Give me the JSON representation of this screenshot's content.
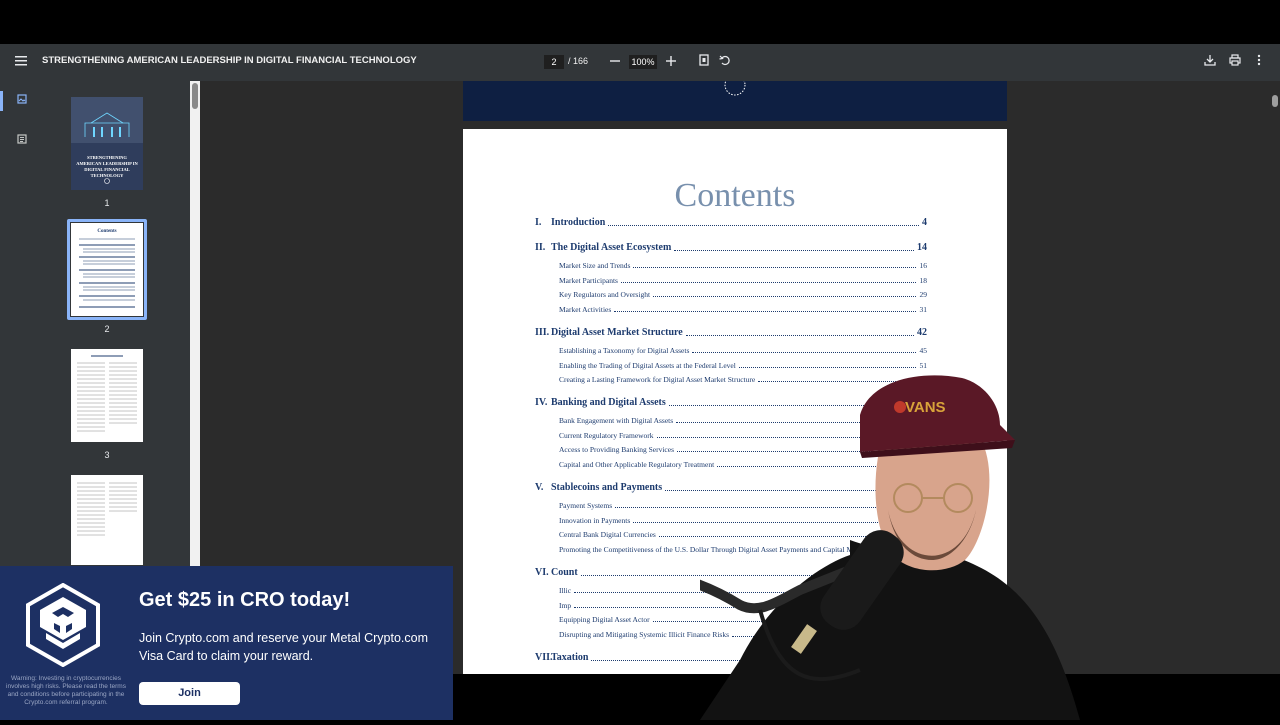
{
  "toolbar": {
    "title": "STRENGTHENING AMERICAN LEADERSHIP IN DIGITAL FINANCIAL TECHNOLOGY",
    "page_current": "2",
    "page_total": "/ 166",
    "zoom": "100%",
    "icons": [
      "menu-icon",
      "zoom-out-icon",
      "zoom-in-icon",
      "fit-page-icon",
      "rotate-icon",
      "download-icon",
      "print-icon",
      "more-icon"
    ]
  },
  "sidebar": {
    "thumbnails": [
      {
        "number": "1",
        "cover_title": "STRENGTHENING AMERICAN LEADERSHIP IN DIGITAL FINANCIAL TECHNOLOGY"
      },
      {
        "number": "2",
        "heading": "Contents"
      },
      {
        "number": "3"
      },
      {
        "number": ""
      }
    ]
  },
  "page": {
    "heading": "Contents",
    "sections": [
      {
        "numeral": "I.",
        "title": "Introduction",
        "page": "4",
        "subs": []
      },
      {
        "numeral": "II.",
        "title": "The Digital Asset Ecosystem",
        "page": "14",
        "subs": [
          {
            "title": "Market Size and Trends",
            "page": "16"
          },
          {
            "title": "Market Participants",
            "page": "18"
          },
          {
            "title": "Key Regulators and Oversight",
            "page": "29"
          },
          {
            "title": "Market Activities",
            "page": "31"
          }
        ]
      },
      {
        "numeral": "III.",
        "title": "Digital Asset Market Structure",
        "page": "42",
        "subs": [
          {
            "title": "Establishing a Taxonomy for Digital Assets",
            "page": "45"
          },
          {
            "title": "Enabling the Trading of Digital Assets at the Federal Level",
            "page": "51"
          },
          {
            "title": "Creating a Lasting Framework for Digital Asset Market Structure",
            "page": ""
          }
        ]
      },
      {
        "numeral": "IV.",
        "title": "Banking and Digital Assets",
        "page": "",
        "subs": [
          {
            "title": "Bank Engagement with Digital Assets",
            "page": ""
          },
          {
            "title": "Current Regulatory Framework",
            "page": ""
          },
          {
            "title": "Access to Providing Banking Services",
            "page": ""
          },
          {
            "title": "Capital and Other Applicable Regulatory Treatment",
            "page": ""
          }
        ]
      },
      {
        "numeral": "V.",
        "title": "Stablecoins and Payments",
        "page": "",
        "subs": [
          {
            "title": "Payment Systems",
            "page": ""
          },
          {
            "title": "Innovation in Payments",
            "page": ""
          },
          {
            "title": "Central Bank Digital Currencies",
            "page": ""
          },
          {
            "title": "Promoting the Competitiveness of the U.S. Dollar Through Digital Asset Payments and Capital M",
            "page": ""
          }
        ]
      },
      {
        "numeral": "VI.",
        "title": "Count",
        "page": "",
        "subs": [
          {
            "title": "Illic",
            "page": ""
          },
          {
            "title": "Imp",
            "page": ""
          },
          {
            "title": "Equipping Digital Asset Actor",
            "page": ""
          },
          {
            "title": "Disrupting and Mitigating Systemic Illicit Finance Risks",
            "page": ""
          }
        ]
      },
      {
        "numeral": "VII.",
        "title": "Taxation",
        "page": "",
        "subs": []
      }
    ]
  },
  "ad": {
    "headline": "Get $25 in CRO today!",
    "body": "Join Crypto.com and reserve your Metal Crypto.com Visa Card to claim your reward.",
    "button": "Join",
    "warning": "Warning: Investing in cryptocurrencies involves high risks. Please read the terms and conditions before participating in the Crypto.com referral program.",
    "logo_icon": "crypto-com-logo",
    "colors": {
      "background": "#1d3063",
      "button": "#ffffff"
    }
  },
  "overlay": {
    "webcam_icon": "streamer-webcam-with-microphone",
    "cap_text": "VANS"
  }
}
